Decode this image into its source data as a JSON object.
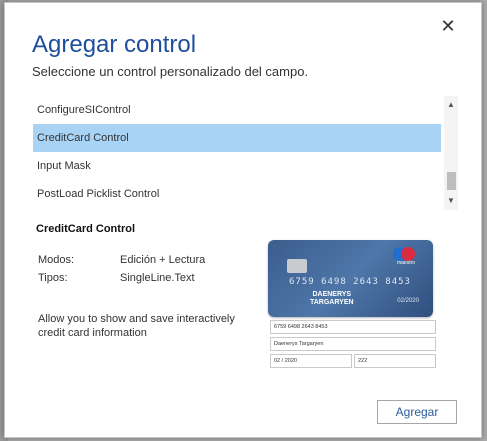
{
  "dialog": {
    "title": "Agregar control",
    "subtitle": "Seleccione un control personalizado del campo.",
    "close_label": "✕",
    "add_button_label": "Agregar"
  },
  "list": {
    "items": [
      {
        "label": "ConfigureSIControl",
        "selected": false
      },
      {
        "label": "CreditCard Control",
        "selected": true
      },
      {
        "label": "Input Mask",
        "selected": false
      },
      {
        "label": "PostLoad Picklist Control",
        "selected": false
      }
    ],
    "scroll_up": "▲",
    "scroll_down": "▼"
  },
  "detail": {
    "name": "CreditCard Control",
    "modes_label": "Modos:",
    "modes_value": "Edición + Lectura",
    "types_label": "Tipos:",
    "types_value": "SingleLine.Text",
    "description": "Allow you to show and save interactively credit card information"
  },
  "preview": {
    "card_number": "6759 6498 2643 8453",
    "holder_line1": "DAENERYS",
    "holder_line2": "TARGARYEN",
    "expiry": "02/2020",
    "logo_text": "maestro",
    "field_number": "6759 6498 2643 8453",
    "field_name": "Daenerys Targaryen",
    "field_expiry": "02 / 2020",
    "field_cvv": "222"
  },
  "colors": {
    "title": "#1f4e9c",
    "selected_row": "#a9d3f5",
    "button_text": "#2a5b9e"
  }
}
